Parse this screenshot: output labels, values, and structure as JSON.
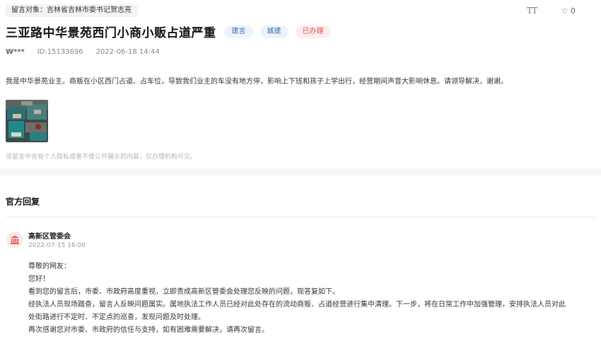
{
  "recipient": {
    "label": "留言对象：",
    "name": "吉林省吉林市委书记贺志亮"
  },
  "actions": {
    "font_icon_text": "TT",
    "favorite_count": "0"
  },
  "post": {
    "title": "三亚路中华景苑西门小商小贩占道严重",
    "tags": [
      "建言",
      "城建",
      "已办理"
    ],
    "author": "W***",
    "id": "ID:15133696",
    "datetime": "2022-06-18 14:44",
    "content": "我是中华景苑业主。商贩在小区西门占道、占车位，导致我们业主的车没有地方停，影响上下班和孩子上学出行，经营期间声音大影响休息。请领导解决，谢谢。",
    "privacy_note": "该留言中含有个人隐私或者不便公开展示的内容，仅办理机构可见。"
  },
  "reply_section": {
    "title": "官方回复",
    "org_name": "高新区管委会",
    "time": "2022-07-15 16:00",
    "lines": [
      "尊敬的网友：",
      "您好！",
      "看到您的留言后，市委、市政府高度重视，立即责成高新区管委会处理您反映的问题，现答复如下。",
      "经执法人员现场踏查，留言人反映问题属实。属地执法工作人员已经对此处存在的流动商贩、占道经营进行集中清理。下一步，将在日常工作中加强管理，安排执法人员对此",
      "处街路进行不定时、不定点的巡查，发现问题及时处理。",
      "再次感谢您对市委、市政府的信任与支持，如有困难需要解决，请再次留言。"
    ]
  },
  "colors": {
    "tag_blue_text": "#3b6fb6",
    "tag_red_text": "#d9534f",
    "org_icon": "#d9534f"
  }
}
